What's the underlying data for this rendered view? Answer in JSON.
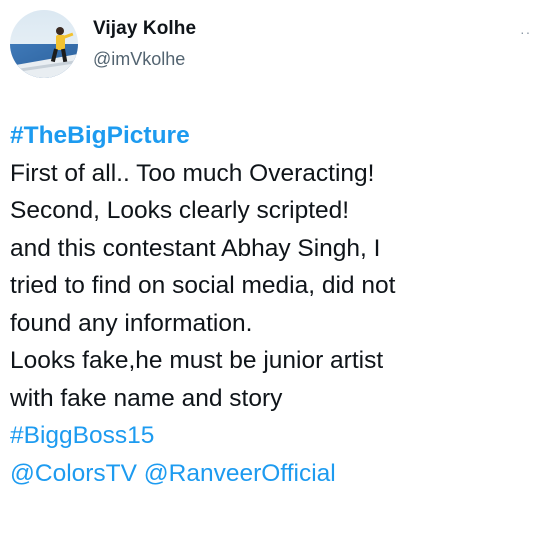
{
  "author": {
    "name": "Vijay Kolhe",
    "handle": "@imVkolhe",
    "avatar_icon": "profile-photo",
    "more_icon": "more-dots-icon",
    "more_glyph": "··"
  },
  "tweet": {
    "hashtag_title": "#TheBigPicture",
    "lines": [
      "First of all.. Too much Overacting!",
      "Second, Looks clearly scripted!",
      "and this contestant Abhay Singh, I",
      "tried to find on social media, did not",
      "found any information.",
      "Looks fake,he must be junior artist",
      "with fake name and story"
    ],
    "hashtag": "#BiggBoss15",
    "mentions": [
      "@ColorsTV",
      "@RanveerOfficial"
    ]
  },
  "colors": {
    "link": "#1d9bf0",
    "text": "#0f1419",
    "secondary": "#536471"
  }
}
